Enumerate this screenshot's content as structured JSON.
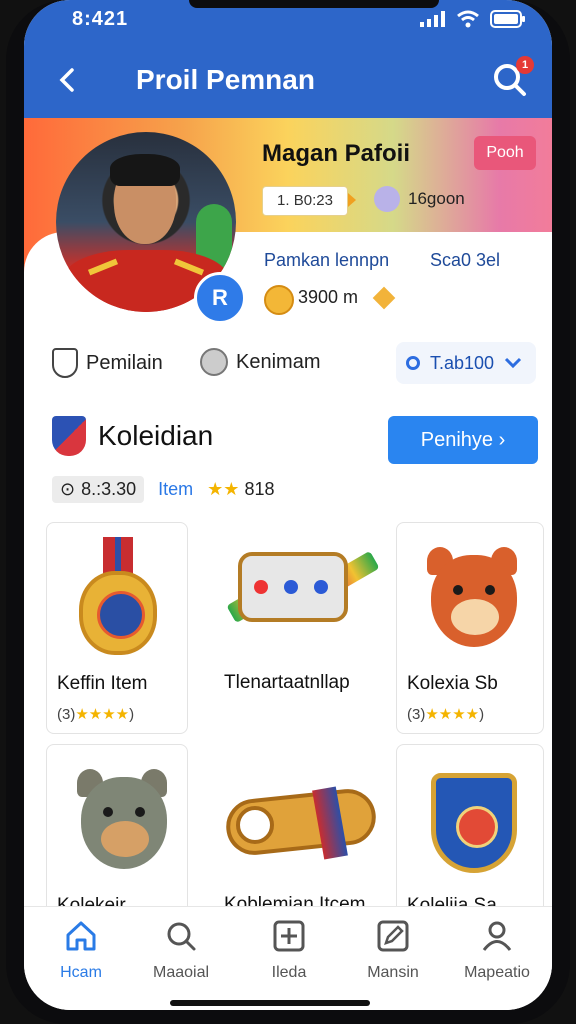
{
  "status": {
    "time": "8:421"
  },
  "header": {
    "title": "Proil Pemnan",
    "notification_count": "1"
  },
  "profile": {
    "name": "Magan Pafoii",
    "action_label": "Pooh",
    "date": "1. B0:23",
    "followers": "16goon",
    "info_left": "Pamkan lennpn",
    "info_right": "Sca0 3el",
    "coins": "3900 m",
    "avatar_badge": "R"
  },
  "stats": {
    "stat1": "Pemilain",
    "stat2": "Kenimam",
    "selector": "T.ab100"
  },
  "collection": {
    "title": "Koleidian",
    "button_label": "Penihye",
    "meta_count": "8.:3.30",
    "meta_link": "Item",
    "meta_rating": "818"
  },
  "items": [
    {
      "name": "Keffin Item",
      "rating": "(3)"
    },
    {
      "name": "Tlenartaatnllap",
      "rating": ""
    },
    {
      "name": "Kolexia Sb",
      "rating": "(3)"
    },
    {
      "name": "Kolekeir",
      "rating": ""
    },
    {
      "name": "Koblemian Itcem",
      "rating": ""
    },
    {
      "name": "Kolelija Sa",
      "rating": ""
    }
  ],
  "tabs": [
    {
      "label": "Hcam",
      "icon": "home-icon"
    },
    {
      "label": "Maaoial",
      "icon": "search-chat-icon"
    },
    {
      "label": "Ileda",
      "icon": "add-icon"
    },
    {
      "label": "Mansin",
      "icon": "edit-icon"
    },
    {
      "label": "Mapeatio",
      "icon": "user-icon"
    }
  ],
  "colors": {
    "header_blue": "#2d66c9",
    "accent_blue": "#2a7be6",
    "star": "#f4b400",
    "pink_button": "#e9577a"
  }
}
